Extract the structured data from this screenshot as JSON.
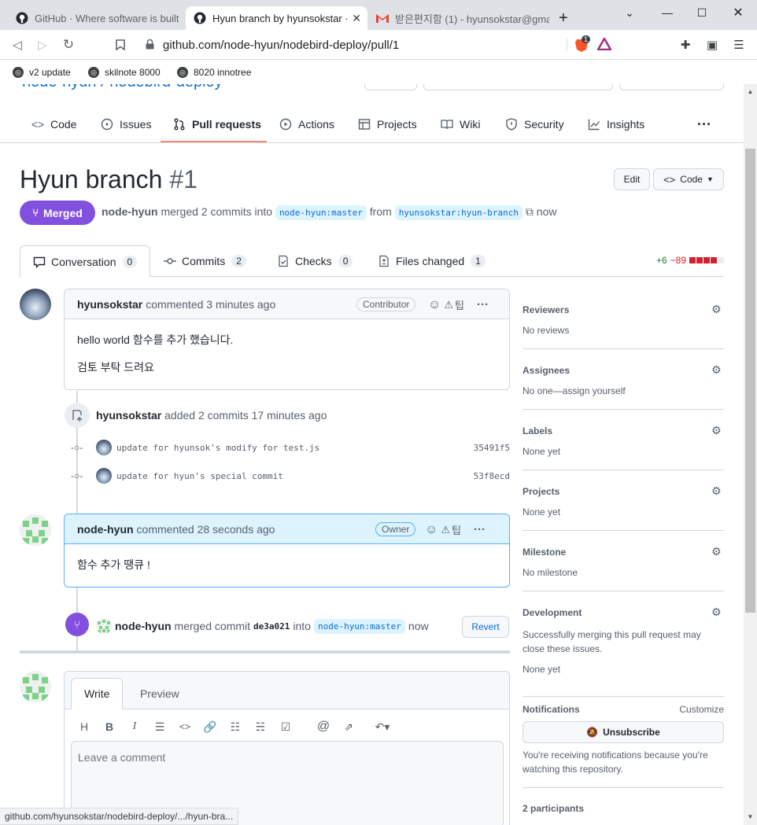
{
  "browser": {
    "tabs": [
      {
        "title": "GitHub · Where software is built",
        "active": false
      },
      {
        "title": "Hyun branch by hyunsokstar · P",
        "active": true
      },
      {
        "title": "받은편지함 (1) - hyunsokstar@gma",
        "active": false
      }
    ],
    "new_tab": "+",
    "url": "github.com/node-hyun/nodebird-deploy/pull/1",
    "bookmarks": [
      "v2 update",
      "skilnote 8000",
      "8020 innotree"
    ],
    "brave_badge": "1",
    "status_url": "github.com/hyunsokstar/nodebird-deploy/.../hyun-bra..."
  },
  "repo": {
    "title": "node-hyun / nodebird-deploy",
    "nav": [
      {
        "label": "Code",
        "icon": "code-icon"
      },
      {
        "label": "Issues",
        "icon": "issue-icon"
      },
      {
        "label": "Pull requests",
        "icon": "pull-request-icon"
      },
      {
        "label": "Actions",
        "icon": "play-icon"
      },
      {
        "label": "Projects",
        "icon": "table-icon"
      },
      {
        "label": "Wiki",
        "icon": "book-icon"
      },
      {
        "label": "Security",
        "icon": "shield-icon"
      },
      {
        "label": "Insights",
        "icon": "graph-icon"
      }
    ],
    "more": "···"
  },
  "pr": {
    "title": "Hyun branch",
    "number": "#1",
    "edit_label": "Edit",
    "code_label": "Code",
    "state": "Merged",
    "author": "node-hyun",
    "merged_text": "merged 2 commits into",
    "base_branch": "node-hyun:master",
    "from_text": "from",
    "head_branch": "hyunsokstar:hyun-branch",
    "time": "now"
  },
  "pr_tabs": [
    {
      "label": "Conversation",
      "count": "0"
    },
    {
      "label": "Commits",
      "count": "2"
    },
    {
      "label": "Checks",
      "count": "0"
    },
    {
      "label": "Files changed",
      "count": "1"
    }
  ],
  "diffstat": {
    "added": "+6",
    "removed": "−89"
  },
  "comments": [
    {
      "author": "hyunsokstar",
      "action": "commented 3 minutes ago",
      "role": "Contributor",
      "reaction_text": "팁",
      "body": [
        "hello world 함수를 추가 했습니다.",
        "검토 부탁 드려요"
      ]
    },
    {
      "author": "node-hyun",
      "action": "commented 28 seconds ago",
      "role": "Owner",
      "reaction_text": "팁",
      "body": [
        "함수 추가 땡큐 !"
      ]
    }
  ],
  "commit_event": {
    "author": "hyunsokstar",
    "text": "added 2 commits 17 minutes ago",
    "commits": [
      {
        "message": "update for hyunsok's modify for test.js",
        "sha": "35491f5"
      },
      {
        "message": "update for hyun's special commit",
        "sha": "53f8ecd"
      }
    ]
  },
  "merge_event": {
    "author": "node-hyun",
    "text": "merged commit",
    "sha": "de3a021",
    "into": "into",
    "branch": "node-hyun:master",
    "time": "now",
    "revert_label": "Revert"
  },
  "write": {
    "tab_write": "Write",
    "tab_preview": "Preview",
    "placeholder": "Leave a comment",
    "tools": [
      "H",
      "B",
      "I"
    ]
  },
  "sidebar": {
    "reviewers": {
      "title": "Reviewers",
      "value": "No reviews"
    },
    "assignees": {
      "title": "Assignees",
      "value": "No one—assign yourself"
    },
    "labels": {
      "title": "Labels",
      "value": "None yet"
    },
    "projects": {
      "title": "Projects",
      "value": "None yet"
    },
    "milestone": {
      "title": "Milestone",
      "value": "No milestone"
    },
    "development": {
      "title": "Development",
      "desc": "Successfully merging this pull request may close these issues.",
      "value": "None yet"
    },
    "notifications": {
      "title": "Notifications",
      "customize": "Customize",
      "button": "Unsubscribe",
      "desc": "You're receiving notifications because you're watching this repository."
    },
    "participants": {
      "title": "2 participants"
    }
  },
  "colors": {
    "accent": "#0969da",
    "merged": "#8250df",
    "added": "#1a7f37",
    "removed": "#cf222e",
    "nav_underline": "#fd8c73"
  }
}
